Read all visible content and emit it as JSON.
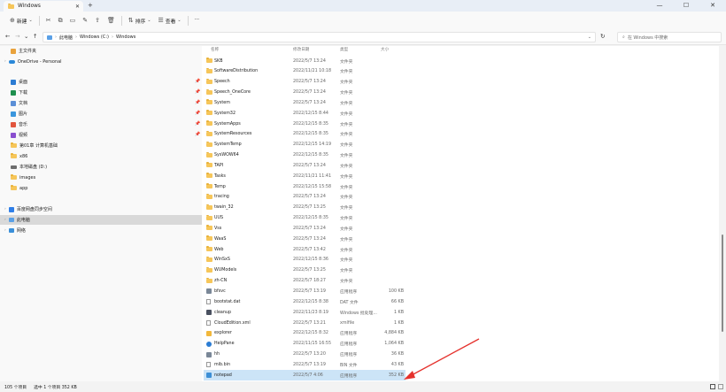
{
  "window": {
    "tab_title": "Windows",
    "new_tab": "+",
    "controls": [
      "—",
      "☐",
      "✕"
    ]
  },
  "toolbar": {
    "new_label": "新建",
    "sort_label": "排序",
    "view_label": "查看",
    "more_label": "···"
  },
  "address": {
    "crumbs": [
      "此电脑",
      "Windows (C:)",
      "Windows"
    ],
    "search_placeholder": "在 Windows 中搜索"
  },
  "sidebar": {
    "items": [
      {
        "label": "主文件夹",
        "icon": "home-icon"
      },
      {
        "label": "OneDrive - Personal",
        "icon": "cloud-icon"
      },
      {
        "label": "桌面",
        "icon": "desktop-icon",
        "pinned": true
      },
      {
        "label": "下载",
        "icon": "download-icon",
        "pinned": true
      },
      {
        "label": "文档",
        "icon": "document-icon",
        "pinned": true
      },
      {
        "label": "图片",
        "icon": "pictures-icon",
        "pinned": true
      },
      {
        "label": "音乐",
        "icon": "music-icon",
        "pinned": true
      },
      {
        "label": "视频",
        "icon": "video-icon",
        "pinned": true
      },
      {
        "label": "第01章 计算机基础",
        "icon": "folder-icon"
      },
      {
        "label": "x86",
        "icon": "folder-icon"
      },
      {
        "label": "本地磁盘 (D:)",
        "icon": "drive-icon"
      },
      {
        "label": "images",
        "icon": "folder-icon"
      },
      {
        "label": "app",
        "icon": "folder-icon"
      },
      {
        "label": "百度网盘同步空间",
        "icon": "baidu-icon"
      },
      {
        "label": "此电脑",
        "icon": "pc-icon",
        "selected": true
      },
      {
        "label": "网络",
        "icon": "network-icon"
      }
    ]
  },
  "columns": {
    "name": "名称",
    "date": "修改日期",
    "type": "类型",
    "size": "大小"
  },
  "files": [
    {
      "name": "SKB",
      "date": "2022/5/7 13:24",
      "type": "文件夹",
      "size": "",
      "kind": "folder"
    },
    {
      "name": "SoftwareDistribution",
      "date": "2022/11/21 10:18",
      "type": "文件夹",
      "size": "",
      "kind": "folder"
    },
    {
      "name": "Speech",
      "date": "2022/5/7 13:24",
      "type": "文件夹",
      "size": "",
      "kind": "folder"
    },
    {
      "name": "Speech_OneCore",
      "date": "2022/5/7 13:24",
      "type": "文件夹",
      "size": "",
      "kind": "folder"
    },
    {
      "name": "System",
      "date": "2022/5/7 13:24",
      "type": "文件夹",
      "size": "",
      "kind": "folder"
    },
    {
      "name": "System32",
      "date": "2022/12/15 8:44",
      "type": "文件夹",
      "size": "",
      "kind": "folder"
    },
    {
      "name": "SystemApps",
      "date": "2022/12/15 8:35",
      "type": "文件夹",
      "size": "",
      "kind": "folder"
    },
    {
      "name": "SystemResources",
      "date": "2022/12/15 8:35",
      "type": "文件夹",
      "size": "",
      "kind": "folder"
    },
    {
      "name": "SystemTemp",
      "date": "2022/12/15 14:19",
      "type": "文件夹",
      "size": "",
      "kind": "folder"
    },
    {
      "name": "SysWOW64",
      "date": "2022/12/15 8:35",
      "type": "文件夹",
      "size": "",
      "kind": "folder"
    },
    {
      "name": "TAPI",
      "date": "2022/5/7 13:24",
      "type": "文件夹",
      "size": "",
      "kind": "folder"
    },
    {
      "name": "Tasks",
      "date": "2022/11/21 11:41",
      "type": "文件夹",
      "size": "",
      "kind": "folder"
    },
    {
      "name": "Temp",
      "date": "2022/12/15 15:58",
      "type": "文件夹",
      "size": "",
      "kind": "folder"
    },
    {
      "name": "tracing",
      "date": "2022/5/7 13:24",
      "type": "文件夹",
      "size": "",
      "kind": "folder"
    },
    {
      "name": "twain_32",
      "date": "2022/5/7 13:25",
      "type": "文件夹",
      "size": "",
      "kind": "folder"
    },
    {
      "name": "UUS",
      "date": "2022/12/15 8:35",
      "type": "文件夹",
      "size": "",
      "kind": "folder"
    },
    {
      "name": "Vss",
      "date": "2022/5/7 13:24",
      "type": "文件夹",
      "size": "",
      "kind": "folder"
    },
    {
      "name": "WaaS",
      "date": "2022/5/7 13:24",
      "type": "文件夹",
      "size": "",
      "kind": "folder"
    },
    {
      "name": "Web",
      "date": "2022/5/7 13:42",
      "type": "文件夹",
      "size": "",
      "kind": "folder"
    },
    {
      "name": "WinSxS",
      "date": "2022/12/15 8:36",
      "type": "文件夹",
      "size": "",
      "kind": "folder"
    },
    {
      "name": "WUModels",
      "date": "2022/5/7 13:25",
      "type": "文件夹",
      "size": "",
      "kind": "folder"
    },
    {
      "name": "zh-CN",
      "date": "2022/5/7 18:27",
      "type": "文件夹",
      "size": "",
      "kind": "folder"
    },
    {
      "name": "bfsvc",
      "date": "2022/5/7 13:19",
      "type": "应用程序",
      "size": "100 KB",
      "kind": "app"
    },
    {
      "name": "bootstat.dat",
      "date": "2022/12/15 8:38",
      "type": "DAT 文件",
      "size": "66 KB",
      "kind": "file"
    },
    {
      "name": "cleanup",
      "date": "2022/11/23 8:19",
      "type": "Windows 批处理...",
      "size": "1 KB",
      "kind": "batch"
    },
    {
      "name": "CloudEdition.xml",
      "date": "2022/5/7 13:21",
      "type": "xmlfile",
      "size": "1 KB",
      "kind": "file"
    },
    {
      "name": "explorer",
      "date": "2022/12/15 8:32",
      "type": "应用程序",
      "size": "4,884 KB",
      "kind": "explorer"
    },
    {
      "name": "HelpPane",
      "date": "2022/11/15 16:55",
      "type": "应用程序",
      "size": "1,064 KB",
      "kind": "help"
    },
    {
      "name": "hh",
      "date": "2022/5/7 13:20",
      "type": "应用程序",
      "size": "36 KB",
      "kind": "app"
    },
    {
      "name": "mib.bin",
      "date": "2022/5/7 13:19",
      "type": "BIN 文件",
      "size": "43 KB",
      "kind": "file"
    },
    {
      "name": "notepad",
      "date": "2022/5/7 4:06",
      "type": "应用程序",
      "size": "352 KB",
      "kind": "notepad",
      "selected": true
    }
  ],
  "status": {
    "count": "105 个项目",
    "selection": "选中 1 个项目 352 KB"
  },
  "colors": {
    "selection": "#cce4f7",
    "folder": "#f6c65a",
    "arrow": "#e5322d"
  }
}
